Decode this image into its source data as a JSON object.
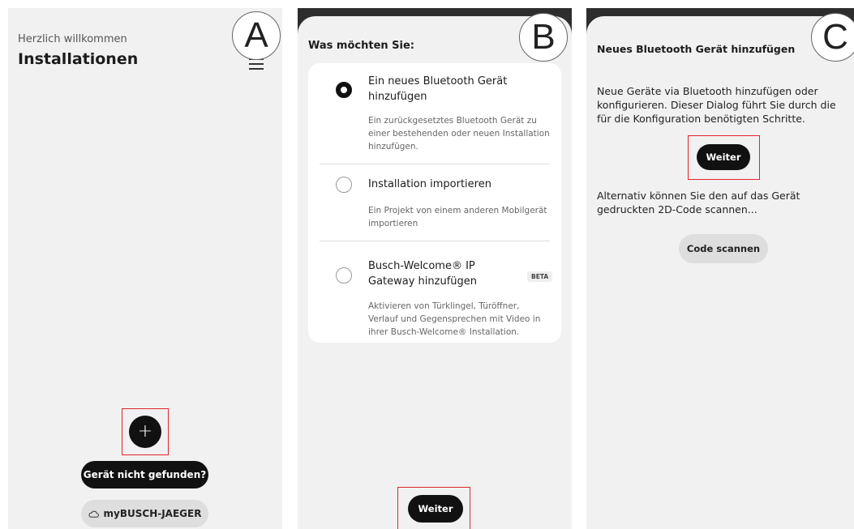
{
  "panel_a": {
    "label": "A",
    "greeting": "Herzlich willkommen",
    "title": "Installationen",
    "menu_icon": "hamburger-menu-icon",
    "add_icon": "+",
    "device_not_found_label": "Gerät nicht gefunden?",
    "cloud_icon": "cloud-icon",
    "mybj_label": "myBUSCH-JAEGER"
  },
  "panel_b": {
    "label": "B",
    "title": "Was möchten Sie:",
    "options": [
      {
        "title": "Ein neues Bluetooth Gerät hinzufügen",
        "description": "Ein zurückgesetztes Bluetooth Gerät zu einer bestehenden oder neuen Installation hinzufügen.",
        "selected": true
      },
      {
        "title": "Installation importieren",
        "description": "Ein Projekt von einem anderen Mobilgerät importieren",
        "selected": false
      },
      {
        "title": "Busch-Welcome® IP Gateway hinzufügen",
        "badge": "BETA",
        "description": "Aktivieren von Türklingel, Türöffner, Verlauf und Gegensprechen mit Video in ihrer Busch-Welcome® Installation.",
        "selected": false
      }
    ],
    "next_label": "Weiter"
  },
  "panel_c": {
    "label": "C",
    "title": "Neues Bluetooth Gerät hinzufügen",
    "intro": "Neue Geräte via Bluetooth hinzufügen oder konfigurieren. Dieser Dialog führt Sie durch die für die Konfiguration benötigten Schritte.",
    "next_label": "Weiter",
    "alt_text": "Alternativ können Sie den auf das Gerät gedruckten 2D-Code scannen...",
    "scan_label": "Code scannen"
  },
  "colors": {
    "highlight_box": "#e5222c",
    "button_dark": "#111111",
    "button_light": "#dedede",
    "panel_bg": "#f1f1f1",
    "status_bar": "#2d2d2d"
  }
}
